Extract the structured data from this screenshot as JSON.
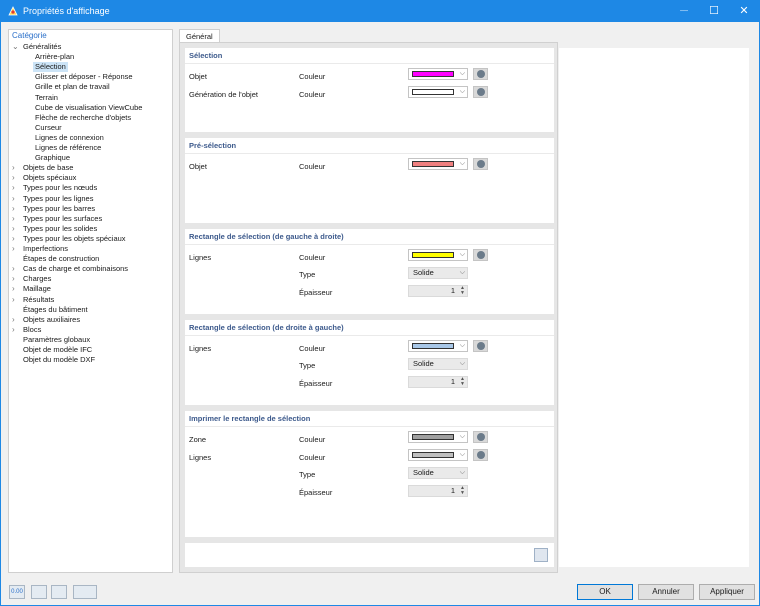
{
  "window": {
    "title": "Propriétés d'affichage",
    "controls": [
      "─",
      "☐",
      "✕"
    ]
  },
  "tree": {
    "header": "Catégorie",
    "items": [
      {
        "label": "Généralités",
        "depth": 0,
        "expander": "open"
      },
      {
        "label": "Arrière-plan",
        "depth": 1
      },
      {
        "label": "Sélection",
        "depth": 1,
        "selected": true
      },
      {
        "label": "Glisser et déposer - Réponse",
        "depth": 1
      },
      {
        "label": "Grille et plan de travail",
        "depth": 1
      },
      {
        "label": "Terrain",
        "depth": 1
      },
      {
        "label": "Cube de visualisation ViewCube",
        "depth": 1
      },
      {
        "label": "Flèche de recherche d'objets",
        "depth": 1
      },
      {
        "label": "Curseur",
        "depth": 1
      },
      {
        "label": "Lignes de connexion",
        "depth": 1
      },
      {
        "label": "Lignes de référence",
        "depth": 1
      },
      {
        "label": "Graphique",
        "depth": 1
      },
      {
        "label": "Objets de base",
        "depth": 0,
        "expander": "closed"
      },
      {
        "label": "Objets spéciaux",
        "depth": 0,
        "expander": "closed"
      },
      {
        "label": "Types pour les nœuds",
        "depth": 0,
        "expander": "closed"
      },
      {
        "label": "Types pour les lignes",
        "depth": 0,
        "expander": "closed"
      },
      {
        "label": "Types pour les barres",
        "depth": 0,
        "expander": "closed"
      },
      {
        "label": "Types pour les surfaces",
        "depth": 0,
        "expander": "closed"
      },
      {
        "label": "Types pour les solides",
        "depth": 0,
        "expander": "closed"
      },
      {
        "label": "Types pour les objets spéciaux",
        "depth": 0,
        "expander": "closed"
      },
      {
        "label": "Imperfections",
        "depth": 0,
        "expander": "closed"
      },
      {
        "label": "Étapes de construction",
        "depth": 0
      },
      {
        "label": "Cas de charge et combinaisons",
        "depth": 0,
        "expander": "closed"
      },
      {
        "label": "Charges",
        "depth": 0,
        "expander": "closed"
      },
      {
        "label": "Maillage",
        "depth": 0,
        "expander": "closed"
      },
      {
        "label": "Résultats",
        "depth": 0,
        "expander": "closed"
      },
      {
        "label": "Étages du bâtiment",
        "depth": 0
      },
      {
        "label": "Objets auxiliaires",
        "depth": 0,
        "expander": "closed"
      },
      {
        "label": "Blocs",
        "depth": 0,
        "expander": "closed"
      },
      {
        "label": "Paramètres globaux",
        "depth": 0
      },
      {
        "label": "Objet de modèle IFC",
        "depth": 0
      },
      {
        "label": "Objet du modèle DXF",
        "depth": 0
      }
    ]
  },
  "tab": {
    "label": "Général"
  },
  "sections": {
    "selection": {
      "title": "Sélection",
      "objet": "Objet",
      "generation": "Génération de l'objet",
      "couleur": "Couleur",
      "color_objet": "#ff00ff",
      "color_generation": "#ffffff"
    },
    "preselection": {
      "title": "Pré-sélection",
      "objet": "Objet",
      "couleur": "Couleur",
      "color_objet": "#f08080"
    },
    "rect_gd": {
      "title": "Rectangle de sélection (de gauche à droite)",
      "lignes": "Lignes",
      "couleur": "Couleur",
      "type": "Type",
      "epaisseur": "Épaisseur",
      "color": "#ffff00",
      "type_value": "Solide",
      "epaisseur_value": "1"
    },
    "rect_dg": {
      "title": "Rectangle de sélection (de droite à gauche)",
      "lignes": "Lignes",
      "couleur": "Couleur",
      "type": "Type",
      "epaisseur": "Épaisseur",
      "color": "#a9c8e8",
      "type_value": "Solide",
      "epaisseur_value": "1"
    },
    "imprimer": {
      "title": "Imprimer le rectangle de sélection",
      "zone": "Zone",
      "lignes": "Lignes",
      "couleur": "Couleur",
      "type": "Type",
      "epaisseur": "Épaisseur",
      "color_zone": "#a0a0a0",
      "color_lignes": "#c0c0c0",
      "type_value": "Solide",
      "epaisseur_value": "1"
    }
  },
  "footer": {
    "icon_units": "0.00",
    "icons": [
      "units-icon",
      "color-palette-icon",
      "save-icon",
      "copy-settings-icon"
    ],
    "ok": "OK",
    "annuler": "Annuler",
    "appliquer": "Appliquer"
  },
  "colors": {
    "accent": "#1e88e5",
    "tree_header": "#2a6fc9",
    "section_title": "#3d5a8c",
    "selection_highlight": "#cce4f7"
  }
}
